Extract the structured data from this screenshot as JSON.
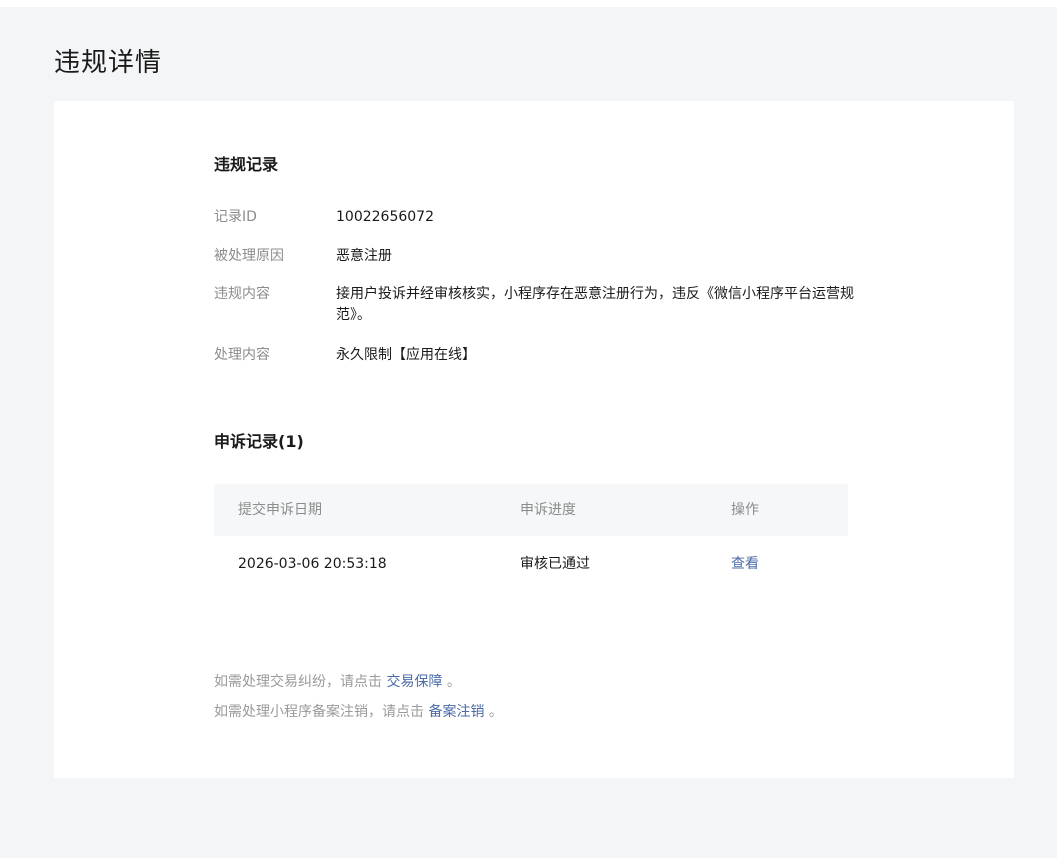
{
  "page": {
    "title": "违规详情"
  },
  "violation_record": {
    "section_title": "违规记录",
    "rows": [
      {
        "label": "记录ID",
        "value": "10022656072"
      },
      {
        "label": "被处理原因",
        "value": "恶意注册"
      },
      {
        "label": "违规内容",
        "value": "接用户投诉并经审核核实，小程序存在恶意注册行为，违反《微信小程序平台运营规范》。"
      },
      {
        "label": "处理内容",
        "value": "永久限制【应用在线】"
      }
    ]
  },
  "appeal_record": {
    "section_title": "申诉记录(1)",
    "columns": [
      "提交申诉日期",
      "申诉进度",
      "操作"
    ],
    "rows": [
      {
        "date": "2026-03-06 20:53:18",
        "progress": "审核已通过",
        "action": "查看"
      }
    ]
  },
  "notes": [
    {
      "prefix": "如需处理交易纠纷，请点击 ",
      "link": "交易保障",
      "suffix": " 。"
    },
    {
      "prefix": "如需处理小程序备案注销，请点击 ",
      "link": "备案注销",
      "suffix": " 。"
    }
  ],
  "colors": {
    "background": "#f4f5f7",
    "card": "#ffffff",
    "link": "#4a6ba8",
    "label": "#8c8c8c"
  }
}
